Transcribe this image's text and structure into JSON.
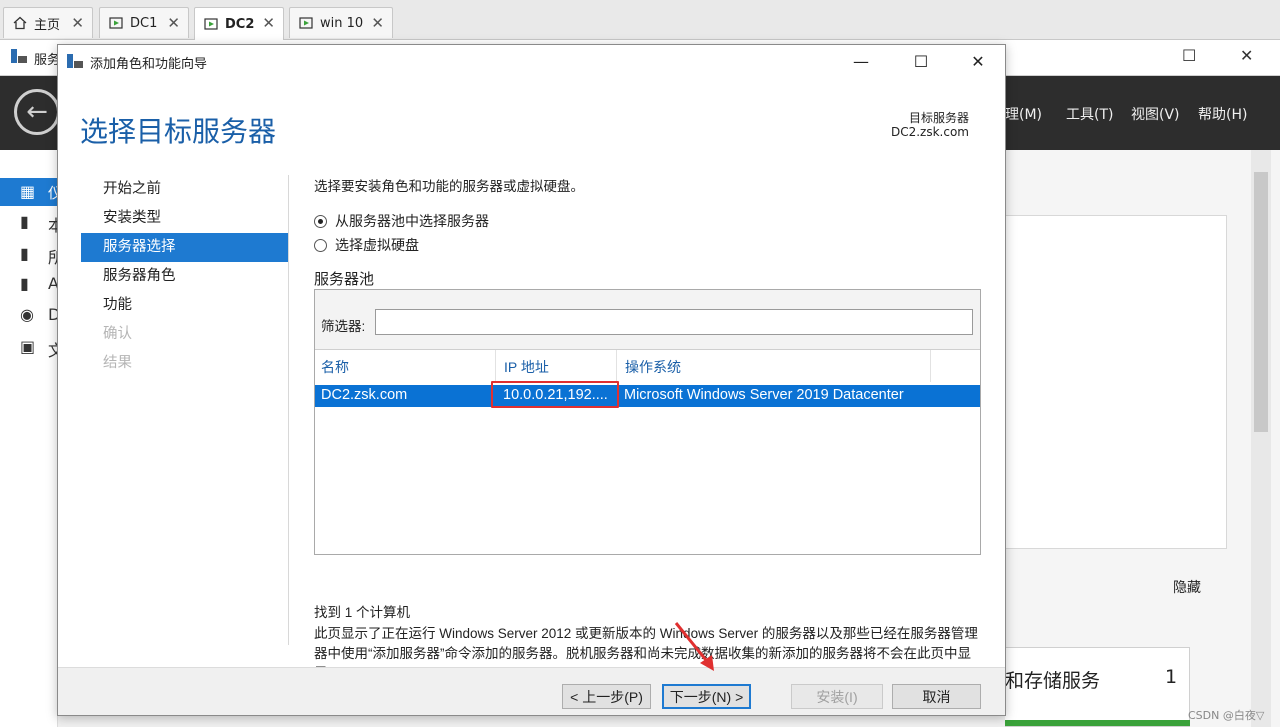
{
  "browser_tabs": [
    {
      "label": "主页",
      "icon": "home-icon"
    },
    {
      "label": "DC1",
      "icon": "vm-icon"
    },
    {
      "label": "DC2",
      "icon": "vm-icon",
      "active": true
    },
    {
      "label": "win 10",
      "icon": "vm-icon"
    }
  ],
  "server_manager": {
    "title": "服务",
    "menus": [
      "理(M)",
      "工具(T)",
      "视图(V)",
      "帮助(H)"
    ],
    "nav_letters": [
      "仪",
      "本",
      "所",
      "A",
      "D",
      "文"
    ],
    "hide_label": "隐藏",
    "tile_title": "和存储服务",
    "tile_count": "1"
  },
  "wizard": {
    "title": "添加角色和功能向导",
    "heading": "选择目标服务器",
    "target_label": "目标服务器",
    "target_value": "DC2.zsk.com",
    "steps": [
      {
        "label": "开始之前",
        "state": "normal"
      },
      {
        "label": "安装类型",
        "state": "normal"
      },
      {
        "label": "服务器选择",
        "state": "active"
      },
      {
        "label": "服务器角色",
        "state": "normal"
      },
      {
        "label": "功能",
        "state": "normal"
      },
      {
        "label": "确认",
        "state": "disabled"
      },
      {
        "label": "结果",
        "state": "disabled"
      }
    ],
    "description": "选择要安装角色和功能的服务器或虚拟硬盘。",
    "radio_pool": "从服务器池中选择服务器",
    "radio_vhd": "选择虚拟硬盘",
    "pool_label": "服务器池",
    "filter_label": "筛选器:",
    "filter_value": "",
    "columns": {
      "name": "名称",
      "ip": "IP 地址",
      "os": "操作系统"
    },
    "row": {
      "name": "DC2.zsk.com",
      "ip": "10.0.0.21,192....",
      "os": "Microsoft Windows Server 2019 Datacenter"
    },
    "found": "找到 1 个计算机",
    "info": "此页显示了正在运行 Windows Server 2012 或更新版本的 Windows Server 的服务器以及那些已经在服务器管理器中使用“添加服务器”命令添加的服务器。脱机服务器和尚未完成数据收集的新添加的服务器将不会在此页中显示。",
    "buttons": {
      "prev": "< 上一步(P)",
      "next": "下一步(N) >",
      "install": "安装(I)",
      "cancel": "取消"
    }
  },
  "watermark": "CSDN @白夜▽",
  "colors": {
    "accent": "#1e7ad1",
    "highlight_box": "#e03030",
    "annotation_arrow": "#e03030"
  }
}
